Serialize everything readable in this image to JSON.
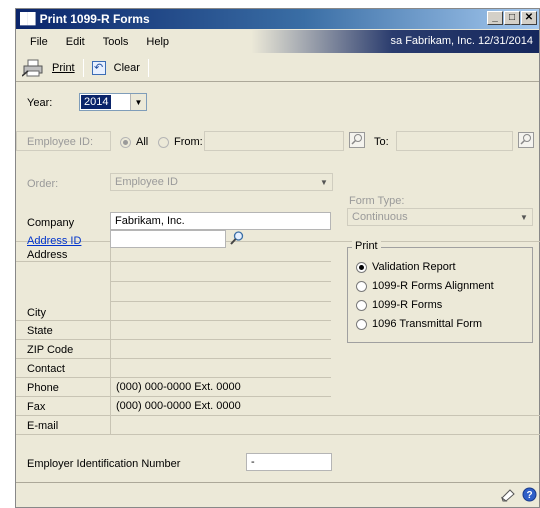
{
  "window": {
    "title": "Print 1099-R Forms"
  },
  "menu": {
    "items": [
      "File",
      "Edit",
      "Tools",
      "Help"
    ],
    "status": "sa  Fabrikam, Inc.  12/31/2014"
  },
  "toolbar": {
    "print_label": "Print",
    "clear_label": "Clear"
  },
  "year": {
    "label": "Year:",
    "value": "2014"
  },
  "employee": {
    "label": "Employee ID:",
    "all_label": "All",
    "from_label": "From:",
    "to_label": "To:"
  },
  "order": {
    "label": "Order:",
    "value": "Employee ID"
  },
  "form_type": {
    "label": "Form Type:",
    "value": "Continuous"
  },
  "company": {
    "company_label": "Company",
    "company_value": "Fabrikam, Inc.",
    "address_id_label": "Address ID",
    "address_id_value": "",
    "address_label": "Address",
    "city_label": "City",
    "state_label": "State",
    "zip_label": "ZIP Code",
    "contact_label": "Contact",
    "phone_label": "Phone",
    "phone_value": "(000) 000-0000  Ext. 0000",
    "fax_label": "Fax",
    "fax_value": "(000) 000-0000  Ext. 0000",
    "email_label": "E-mail"
  },
  "print_group": {
    "label": "Print",
    "options": [
      "Validation Report",
      "1099-R Forms Alignment",
      "1099-R Forms",
      "1096 Transmittal Form"
    ],
    "selected": 0
  },
  "ein": {
    "label": "Employer Identification Number",
    "value": "-"
  }
}
